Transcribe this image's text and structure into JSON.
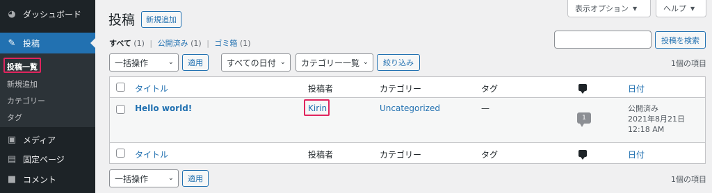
{
  "sidebar": {
    "items": [
      {
        "label": "ダッシュボード",
        "icon": "dashboard-icon"
      },
      {
        "label": "投稿",
        "icon": "pin-icon",
        "active": true
      },
      {
        "label": "メディア",
        "icon": "media-icon"
      },
      {
        "label": "固定ページ",
        "icon": "page-icon"
      },
      {
        "label": "コメント",
        "icon": "comment-icon"
      }
    ],
    "submenu": [
      "投稿一覧",
      "新規追加",
      "カテゴリー",
      "タグ"
    ]
  },
  "header": {
    "title": "投稿",
    "add_new": "新規追加",
    "screen_options": "表示オプション",
    "help": "ヘルプ"
  },
  "views": {
    "all": "すべて",
    "all_count": "(1)",
    "published": "公開済み",
    "published_count": "(1)",
    "trash": "ゴミ箱",
    "trash_count": "(1)"
  },
  "search": {
    "value": "",
    "button": "投稿を検索"
  },
  "filters": {
    "bulk_action": "一括操作",
    "apply": "適用",
    "date": "すべての日付",
    "category": "カテゴリー一覧",
    "filter": "絞り込み"
  },
  "item_count": "1個の項目",
  "table": {
    "columns": {
      "title": "タイトル",
      "author": "投稿者",
      "categories": "カテゴリー",
      "tags": "タグ",
      "date": "日付"
    },
    "rows": [
      {
        "title": "Hello world!",
        "author": "Kirin",
        "category": "Uncategorized",
        "tags": "—",
        "comments": "1",
        "status": "公開済み",
        "date": "2021年8月21日",
        "time": "12:18 AM"
      }
    ]
  },
  "colors": {
    "sidebar_bg": "#1d2327",
    "accent": "#2271b1",
    "highlight": "#e0245e"
  }
}
